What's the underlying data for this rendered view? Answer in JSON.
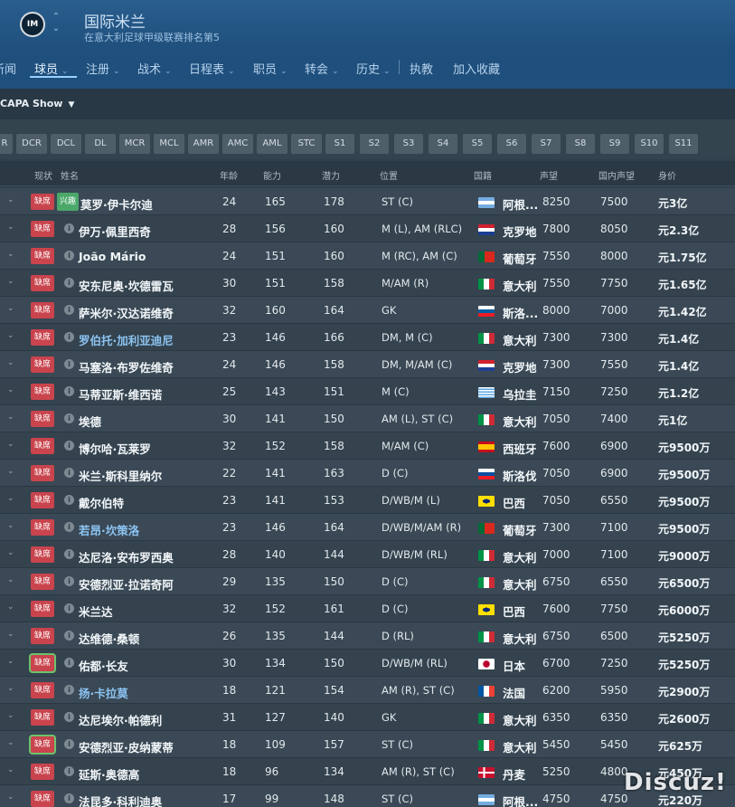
{
  "header": {
    "club_name": "国际米兰",
    "club_subtitle": "在意大利足球甲级联赛排名第5",
    "badge_text": "IM"
  },
  "nav": {
    "items": [
      {
        "label": "新闻",
        "chevron": false
      },
      {
        "label": "球员",
        "chevron": true,
        "active": true
      },
      {
        "label": "注册",
        "chevron": true
      },
      {
        "label": "战术",
        "chevron": true
      },
      {
        "label": "日程表",
        "chevron": true
      },
      {
        "label": "职员",
        "chevron": true
      },
      {
        "label": "转会",
        "chevron": true
      },
      {
        "label": "历史",
        "chevron": true
      },
      {
        "label": "执教",
        "chevron": false
      },
      {
        "label": "加入收藏",
        "chevron": false
      }
    ]
  },
  "view": {
    "label": "CAPA Show"
  },
  "filters": [
    "R",
    "DCR",
    "DCL",
    "DL",
    "MCR",
    "MCL",
    "AMR",
    "AMC",
    "AML",
    "STC",
    "S1",
    "S2",
    "S3",
    "S4",
    "S5",
    "S6",
    "S7",
    "S8",
    "S9",
    "S10",
    "S11"
  ],
  "columns": {
    "status": "现状",
    "name": "姓名",
    "age": "年龄",
    "ca": "能力",
    "pa": "潜力",
    "position": "位置",
    "nationality": "国籍",
    "reputation": "声望",
    "home_reputation": "国内声望",
    "value": "身价"
  },
  "status_label": "缺席",
  "colors": {
    "status_red": "#c9444d",
    "tag_green": "#4ba86a",
    "link_blue": "#8cc4f2",
    "header_blue": "#1f4f7c"
  },
  "players": [
    {
      "name": "莫罗·伊卡尔迪",
      "tag": "兴趣",
      "age": "24",
      "ca": "165",
      "pa": "178",
      "pos": "ST (C)",
      "flag": "argentina",
      "nat": "阿根...",
      "rep": "8250",
      "hrep": "7500",
      "value": "元3亿"
    },
    {
      "name": "伊万·佩里西奇",
      "age": "28",
      "ca": "156",
      "pa": "160",
      "pos": "M (L), AM (RLC)",
      "flag": "croatia",
      "nat": "克罗地",
      "rep": "7800",
      "hrep": "8050",
      "value": "元2.3亿"
    },
    {
      "name": "João Mário",
      "age": "24",
      "ca": "151",
      "pa": "160",
      "pos": "M (RC), AM (C)",
      "flag": "portugal",
      "nat": "葡萄牙",
      "rep": "7550",
      "hrep": "8000",
      "value": "元1.75亿"
    },
    {
      "name": "安东尼奥·坎德雷瓦",
      "age": "30",
      "ca": "151",
      "pa": "158",
      "pos": "M/AM (R)",
      "flag": "italy",
      "nat": "意大利",
      "rep": "7550",
      "hrep": "7750",
      "value": "元1.65亿"
    },
    {
      "name": "萨米尔·汉达诺维奇",
      "age": "32",
      "ca": "160",
      "pa": "164",
      "pos": "GK",
      "flag": "slovenia",
      "nat": "斯洛...",
      "rep": "8000",
      "hrep": "7000",
      "value": "元1.42亿"
    },
    {
      "name": "罗伯托·加利亚迪尼",
      "link": true,
      "age": "23",
      "ca": "146",
      "pa": "166",
      "pos": "DM, M (C)",
      "flag": "italy",
      "nat": "意大利",
      "rep": "7300",
      "hrep": "7300",
      "value": "元1.4亿"
    },
    {
      "name": "马塞洛·布罗佐维奇",
      "age": "24",
      "ca": "146",
      "pa": "158",
      "pos": "DM, M/AM (C)",
      "flag": "croatia",
      "nat": "克罗地",
      "rep": "7300",
      "hrep": "7550",
      "value": "元1.4亿"
    },
    {
      "name": "马蒂亚斯·维西诺",
      "age": "25",
      "ca": "143",
      "pa": "151",
      "pos": "M (C)",
      "flag": "uruguay",
      "nat": "乌拉圭",
      "rep": "7150",
      "hrep": "7250",
      "value": "元1.2亿"
    },
    {
      "name": "埃德",
      "age": "30",
      "ca": "141",
      "pa": "150",
      "pos": "AM (L), ST (C)",
      "flag": "italy",
      "nat": "意大利",
      "rep": "7050",
      "hrep": "7400",
      "value": "元1亿"
    },
    {
      "name": "博尔哈·瓦莱罗",
      "age": "32",
      "ca": "152",
      "pa": "158",
      "pos": "M/AM (C)",
      "flag": "spain",
      "nat": "西班牙",
      "rep": "7600",
      "hrep": "6900",
      "value": "元9500万"
    },
    {
      "name": "米兰·斯科里纳尔",
      "age": "22",
      "ca": "141",
      "pa": "163",
      "pos": "D (C)",
      "flag": "slovakia",
      "nat": "斯洛伐",
      "rep": "7050",
      "hrep": "6900",
      "value": "元9500万"
    },
    {
      "name": "戴尔伯特",
      "age": "23",
      "ca": "141",
      "pa": "153",
      "pos": "D/WB/M (L)",
      "flag": "brazil",
      "nat": "巴西",
      "rep": "7050",
      "hrep": "6550",
      "value": "元9500万"
    },
    {
      "name": "若昂·坎策洛",
      "link": true,
      "age": "23",
      "ca": "146",
      "pa": "164",
      "pos": "D/WB/M/AM (R)",
      "flag": "portugal",
      "nat": "葡萄牙",
      "rep": "7300",
      "hrep": "7100",
      "value": "元9500万"
    },
    {
      "name": "达尼洛·安布罗西奥",
      "age": "28",
      "ca": "140",
      "pa": "144",
      "pos": "D/WB/M (RL)",
      "flag": "italy",
      "nat": "意大利",
      "rep": "7000",
      "hrep": "7100",
      "value": "元9000万"
    },
    {
      "name": "安德烈亚·拉诺奇阿",
      "age": "29",
      "ca": "135",
      "pa": "150",
      "pos": "D (C)",
      "flag": "italy",
      "nat": "意大利",
      "rep": "6750",
      "hrep": "6550",
      "value": "元6500万"
    },
    {
      "name": "米兰达",
      "age": "32",
      "ca": "152",
      "pa": "161",
      "pos": "D (C)",
      "flag": "brazil",
      "nat": "巴西",
      "rep": "7600",
      "hrep": "7750",
      "value": "元6000万"
    },
    {
      "name": "达维德·桑顿",
      "age": "26",
      "ca": "135",
      "pa": "144",
      "pos": "D (RL)",
      "flag": "italy",
      "nat": "意大利",
      "rep": "6750",
      "hrep": "6500",
      "value": "元5250万"
    },
    {
      "name": "佑都·长友",
      "outline": true,
      "age": "30",
      "ca": "134",
      "pa": "150",
      "pos": "D/WB/M (RL)",
      "flag": "japan",
      "nat": "日本",
      "rep": "6700",
      "hrep": "7250",
      "value": "元5250万"
    },
    {
      "name": "扬·卡拉莫",
      "link": true,
      "age": "18",
      "ca": "121",
      "pa": "154",
      "pos": "AM (R), ST (C)",
      "flag": "france",
      "nat": "法国",
      "rep": "6200",
      "hrep": "5950",
      "value": "元2900万"
    },
    {
      "name": "达尼埃尔·帕德利",
      "age": "31",
      "ca": "127",
      "pa": "140",
      "pos": "GK",
      "flag": "italy",
      "nat": "意大利",
      "rep": "6350",
      "hrep": "6350",
      "value": "元2600万"
    },
    {
      "name": "安德烈亚·皮纳蒙蒂",
      "outline": true,
      "age": "18",
      "ca": "109",
      "pa": "157",
      "pos": "ST (C)",
      "flag": "italy",
      "nat": "意大利",
      "rep": "5450",
      "hrep": "5450",
      "value": "元625万"
    },
    {
      "name": "延斯·奥德高",
      "age": "18",
      "ca": "96",
      "pa": "134",
      "pos": "AM (R), ST (C)",
      "flag": "denmark",
      "nat": "丹麦",
      "rep": "5250",
      "hrep": "4800",
      "value": "元450万"
    },
    {
      "name": "法昆多·科利迪奥",
      "age": "17",
      "ca": "99",
      "pa": "148",
      "pos": "ST (C)",
      "flag": "argentina",
      "nat": "阿根...",
      "rep": "4750",
      "hrep": "4750",
      "value": "元220万"
    }
  ],
  "watermark": "Discuz!"
}
